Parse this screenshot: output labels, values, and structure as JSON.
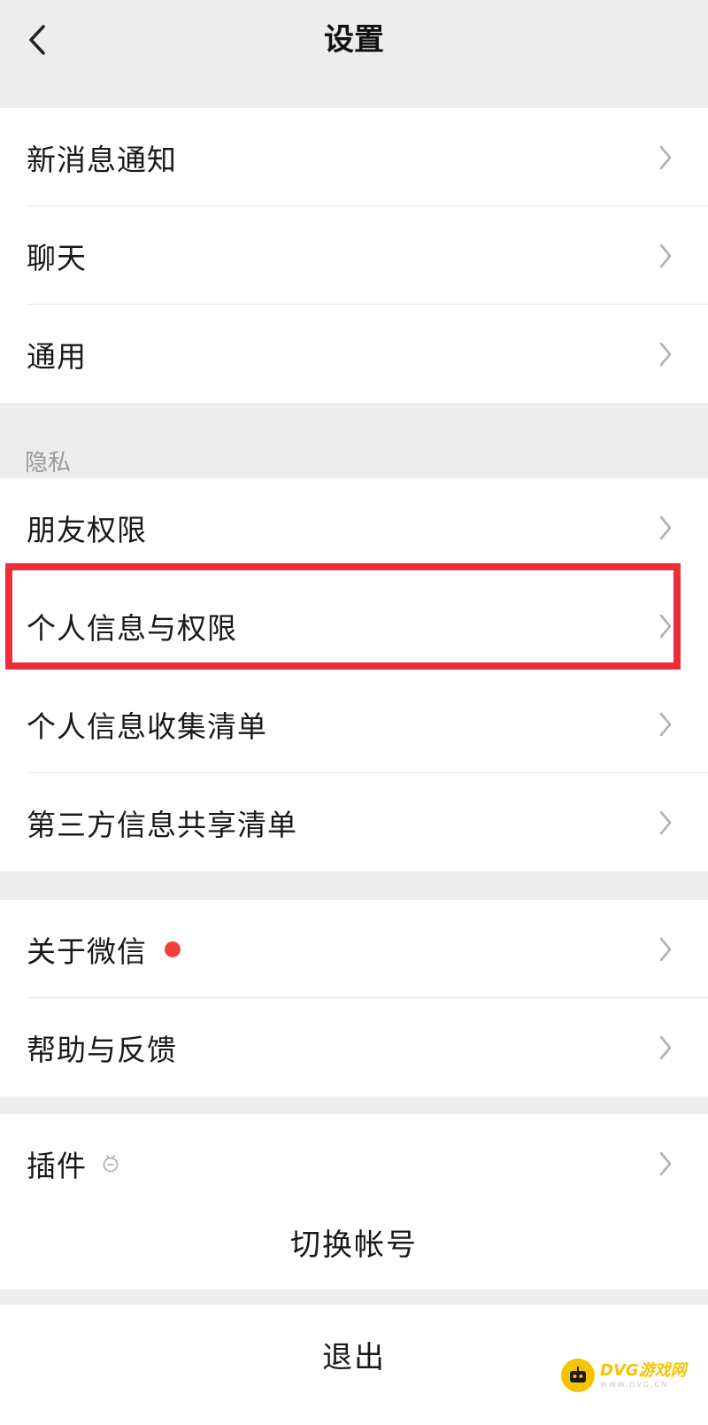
{
  "nav": {
    "title": "设置"
  },
  "group1": [
    {
      "label": "新消息通知"
    },
    {
      "label": "聊天"
    },
    {
      "label": "通用"
    }
  ],
  "privacy_header": "隐私",
  "privacy": [
    {
      "label": "朋友权限"
    },
    {
      "label": "个人信息与权限"
    },
    {
      "label": "个人信息收集清单"
    },
    {
      "label": "第三方信息共享清单"
    }
  ],
  "about": [
    {
      "label": "关于微信",
      "badge": "red-dot"
    },
    {
      "label": "帮助与反馈"
    }
  ],
  "plugins": {
    "label": "插件",
    "icon": "plugin-icon"
  },
  "switch_account": "切换帐号",
  "logout": "退出",
  "watermark": {
    "main": "DVG游戏网",
    "sub": "WWW.DVG.CN"
  },
  "colors": {
    "background": "#ededed",
    "cell": "#ffffff",
    "badge": "#f04142",
    "highlight": "#ee2e36",
    "chevron": "#b2b2b2"
  }
}
